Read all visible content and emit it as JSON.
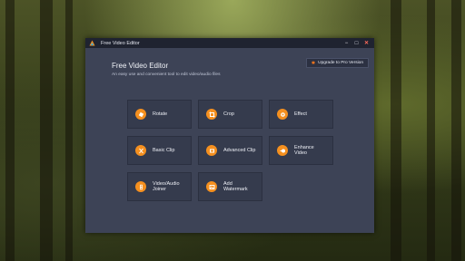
{
  "window": {
    "title": "Free Video Editor",
    "controls": {
      "minimize": "−",
      "maximize": "□",
      "close": "✕"
    }
  },
  "header": {
    "title": "Free Video Editor",
    "subtitle": "An easy use and convenient tool to edit video/audio files",
    "upgrade_label": "Upgrade to Pro Version"
  },
  "tools": [
    {
      "label": "Rotate",
      "icon": "rotate-icon"
    },
    {
      "label": "Crop",
      "icon": "crop-icon"
    },
    {
      "label": "Effect",
      "icon": "effect-icon"
    },
    {
      "label": "Basic Clip",
      "icon": "scissors-icon"
    },
    {
      "label": "Advanced Clip",
      "icon": "advanced-clip-icon"
    },
    {
      "label": "Enhance\nVideo",
      "icon": "enhance-icon"
    },
    {
      "label": "Video/Audio\nJoiner",
      "icon": "joiner-icon"
    },
    {
      "label": "Add\nWatermark",
      "icon": "watermark-icon"
    }
  ],
  "colors": {
    "accent": "#f5901f",
    "window_bg": "#3d4356",
    "titlebar_bg": "#1f2330",
    "tile_bg": "#353b4d"
  }
}
